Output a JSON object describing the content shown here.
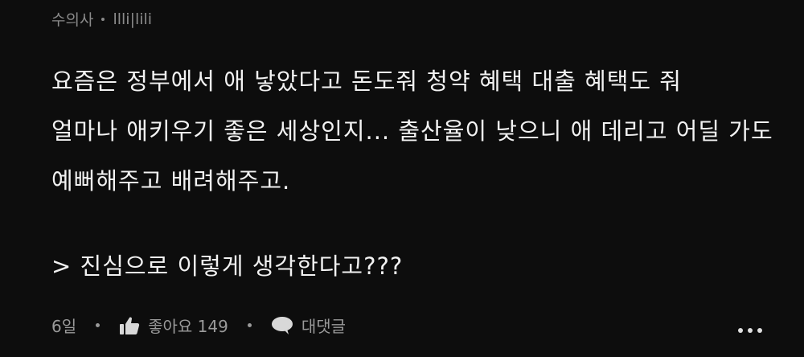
{
  "comment": {
    "author": "수의사",
    "author_tag": "llli|lili",
    "lines": [
      "요즘은 정부에서 애 낳았다고 돈도줘 청약 혜택 대출 혜택도 줘",
      "얼마나 애키우기 좋은 세상인지... 출산율이 낮으니 애 데리고 어딜 가도",
      "예뻐해주고 배려해주고."
    ],
    "quote": "> 진심으로 이렇게 생각한다고???",
    "age": "6일",
    "like_label": "좋아요 149",
    "reply_label": "대댓글"
  },
  "icons": {
    "like": "thumbs-up-icon",
    "reply": "speech-bubble-icon",
    "more": "more-dots-icon"
  },
  "colors": {
    "background": "#0d0d0d",
    "text": "#f2f2f2",
    "muted": "#9a9a9a"
  }
}
